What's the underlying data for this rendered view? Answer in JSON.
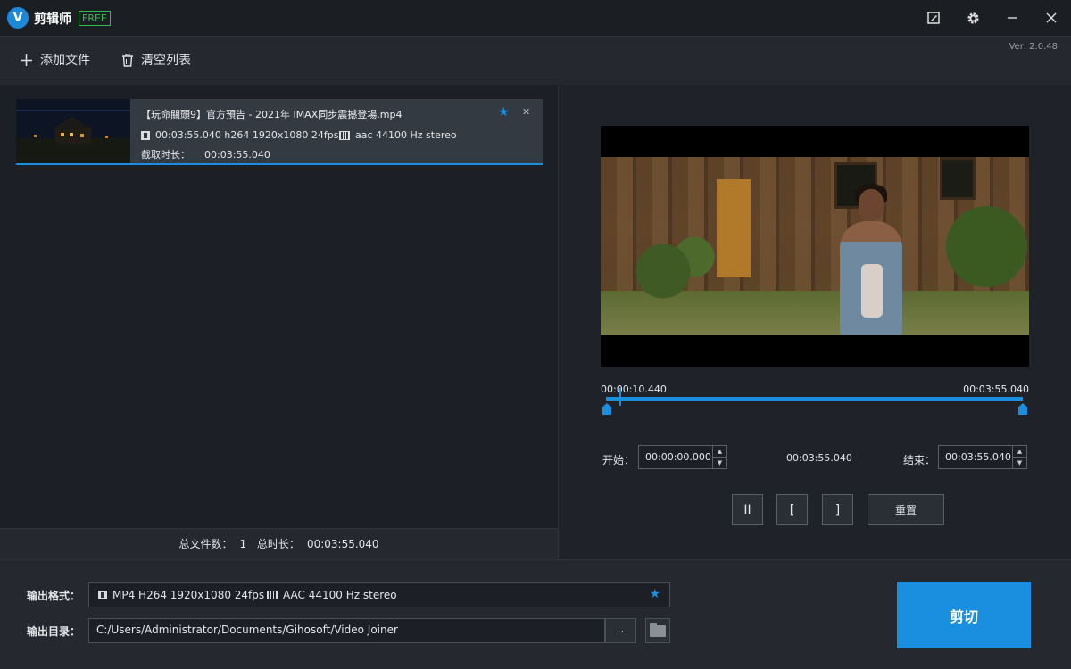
{
  "window": {
    "logo_letter": "V",
    "title": "剪辑师",
    "badge": "FREE",
    "version": "Ver: 2.0.48"
  },
  "toolbar": {
    "add_file": "添加文件",
    "clear_list": "清空列表"
  },
  "file_list": [
    {
      "name": "【玩命關頭9】官方預告 - 2021年 IMAX同步震撼登場.mp4",
      "video_info": "00:03:55.040 h264 1920x1080 24fps",
      "audio_info": "aac 44100 Hz stereo",
      "cut_label": "截取时长：",
      "cut_duration": "00:03:55.040",
      "favorite": true
    }
  ],
  "list_footer": {
    "total_files_label": "总文件数：",
    "total_files": "1",
    "total_duration_label": "总时长：",
    "total_duration": "00:03:55.040"
  },
  "player": {
    "current_time": "00:00:10.440",
    "total_time": "00:03:55.040",
    "start_label": "开始：",
    "start_value": "00:00:00.000",
    "duration_value": "00:03:55.040",
    "end_label": "结束：",
    "end_value": "00:03:55.040",
    "pause_glyph": "II",
    "mark_in_glyph": "[",
    "mark_out_glyph": "]",
    "reset_label": "重置"
  },
  "output": {
    "format_label": "输出格式：",
    "format_video": "MP4 H264 1920x1080 24fps",
    "format_audio": "AAC 44100 Hz stereo",
    "dir_label": "输出目录：",
    "dir_path": "C:/Users/Administrator/Documents/Gihosoft/Video Joiner",
    "browse_label": "..",
    "cut_label": "剪切"
  },
  "icons": {
    "add": "plus-icon",
    "clear": "trash-icon",
    "settings": "gear-icon",
    "skin": "edit-icon",
    "minimize": "minimize-icon",
    "close": "close-icon",
    "favorite": "star-icon",
    "folder": "folder-icon"
  },
  "colors": {
    "accent": "#1a8fe0",
    "free_badge": "#2fbf4a",
    "background": "#1c2026"
  }
}
